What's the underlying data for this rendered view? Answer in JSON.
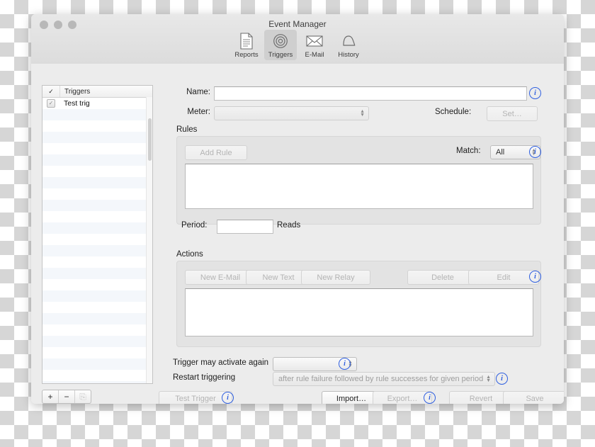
{
  "window": {
    "title": "Event Manager",
    "traffic_lights": [
      "close",
      "minimize",
      "zoom"
    ]
  },
  "toolbar": {
    "items": [
      {
        "label": "Reports",
        "icon": "document-icon",
        "selected": false
      },
      {
        "label": "Triggers",
        "icon": "target-icon",
        "selected": true
      },
      {
        "label": "E-Mail",
        "icon": "envelope-icon",
        "selected": false
      },
      {
        "label": "History",
        "icon": "bell-icon",
        "selected": false
      }
    ]
  },
  "sidebar": {
    "header": {
      "check_glyph": "✓",
      "label": "Triggers"
    },
    "rows": [
      {
        "checked": true,
        "label": "Test trig"
      }
    ],
    "segmented": {
      "add_label": "+",
      "remove_label": "−",
      "duplicate_label": "⎘"
    }
  },
  "form": {
    "name_label": "Name:",
    "name_value": "",
    "name_placeholder": "",
    "meter_label": "Meter:",
    "meter_value": "",
    "schedule_label": "Schedule:",
    "schedule_button": "Set…"
  },
  "rules": {
    "title": "Rules",
    "add_rule_label": "Add Rule",
    "match_label": "Match:",
    "match_value": "All",
    "period_label": "Period:",
    "period_value": "",
    "period_unit": "Reads"
  },
  "actions": {
    "title": "Actions",
    "new_email_label": "New E-Mail",
    "new_text_label": "New Text",
    "new_relay_label": "New Relay",
    "delete_label": "Delete",
    "edit_label": "Edit"
  },
  "options": {
    "activate_again_label": "Trigger may activate again",
    "activate_again_value": "",
    "restart_label": "Restart triggering",
    "restart_value": "after rule failure followed by rule successes for given period"
  },
  "footer": {
    "test_trigger_label": "Test Trigger",
    "import_label": "Import…",
    "export_label": "Export…",
    "revert_label": "Revert",
    "save_label": "Save"
  },
  "colors": {
    "accent_info": "#2f5fe0",
    "window_bg": "#ececec",
    "group_bg": "#e3e3e3",
    "toolbar_selected": "#cfcfcf"
  }
}
